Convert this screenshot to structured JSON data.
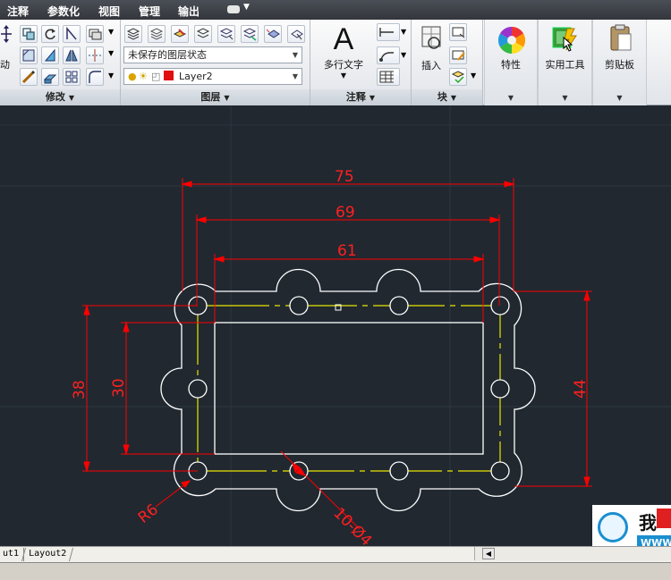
{
  "menu": [
    "注释",
    "参数化",
    "视图",
    "管理",
    "输出"
  ],
  "ribbon": {
    "modify": {
      "title": "修改",
      "cut_label": "动"
    },
    "layers": {
      "title": "图层",
      "state_combo": "未保存的图层状态",
      "layer_combo": "Layer2",
      "layer_color": "#e01010"
    },
    "annotation": {
      "title": "注释",
      "mtext_label": "多行文字",
      "glyph": "A"
    },
    "block": {
      "title": "块",
      "insert_label": "插入"
    },
    "properties": {
      "label": "特性"
    },
    "utilities": {
      "label": "实用工具"
    },
    "clipboard": {
      "label": "剪贴板"
    }
  },
  "drawing": {
    "dims": {
      "d75": "75",
      "d69": "69",
      "d61": "61",
      "d38": "38",
      "d30": "30",
      "d44": "44",
      "radius": "R6",
      "holes": "10-Ø4"
    },
    "colors": {
      "dimension": "#ff0000",
      "outline": "#ffffff",
      "centerline": "#e6e600",
      "background": "#212830"
    }
  },
  "layout_tabs": [
    "ut1",
    "Layout2"
  ],
  "watermark": {
    "text": "我"
  }
}
